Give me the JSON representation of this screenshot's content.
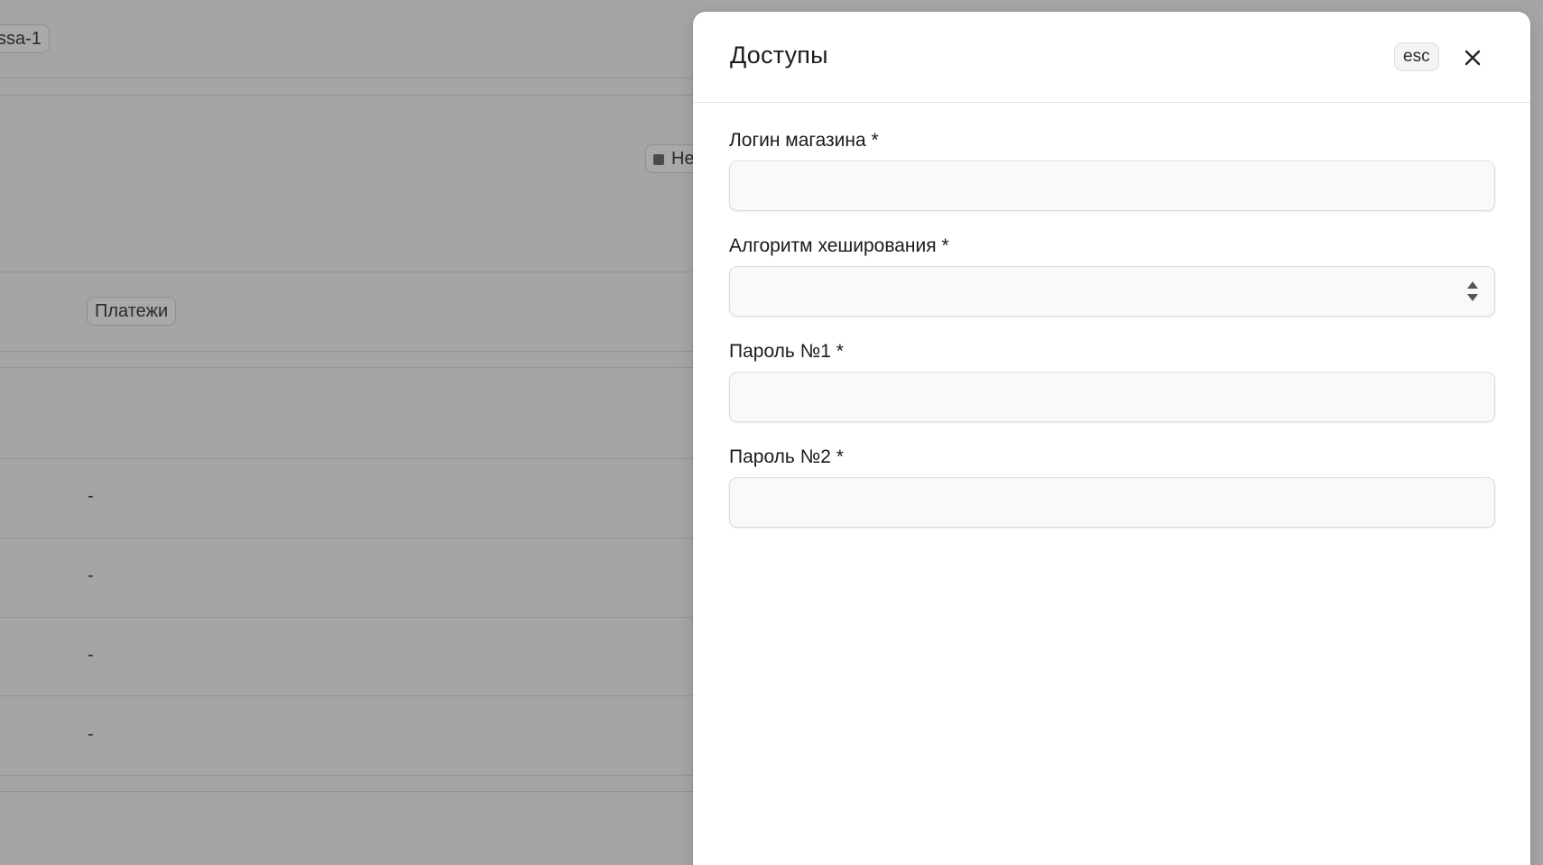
{
  "background": {
    "instance_chip": "ssa-1",
    "status_chip": "Не",
    "payments_chip": "Платежи",
    "row_values": [
      "-",
      "-",
      "-",
      "-"
    ]
  },
  "drawer": {
    "title": "Доступы",
    "esc_label": "esc",
    "fields": [
      {
        "label": "Логин магазина *",
        "value": "",
        "placeholder": ""
      },
      {
        "label": "Алгоритм хеширования *",
        "value": "",
        "placeholder": ""
      },
      {
        "label": "Пароль №1 *",
        "value": "",
        "placeholder": ""
      },
      {
        "label": "Пароль №2 *",
        "value": "",
        "placeholder": ""
      }
    ]
  },
  "icons": {
    "close": "close-icon",
    "select": "select-arrows-icon"
  }
}
